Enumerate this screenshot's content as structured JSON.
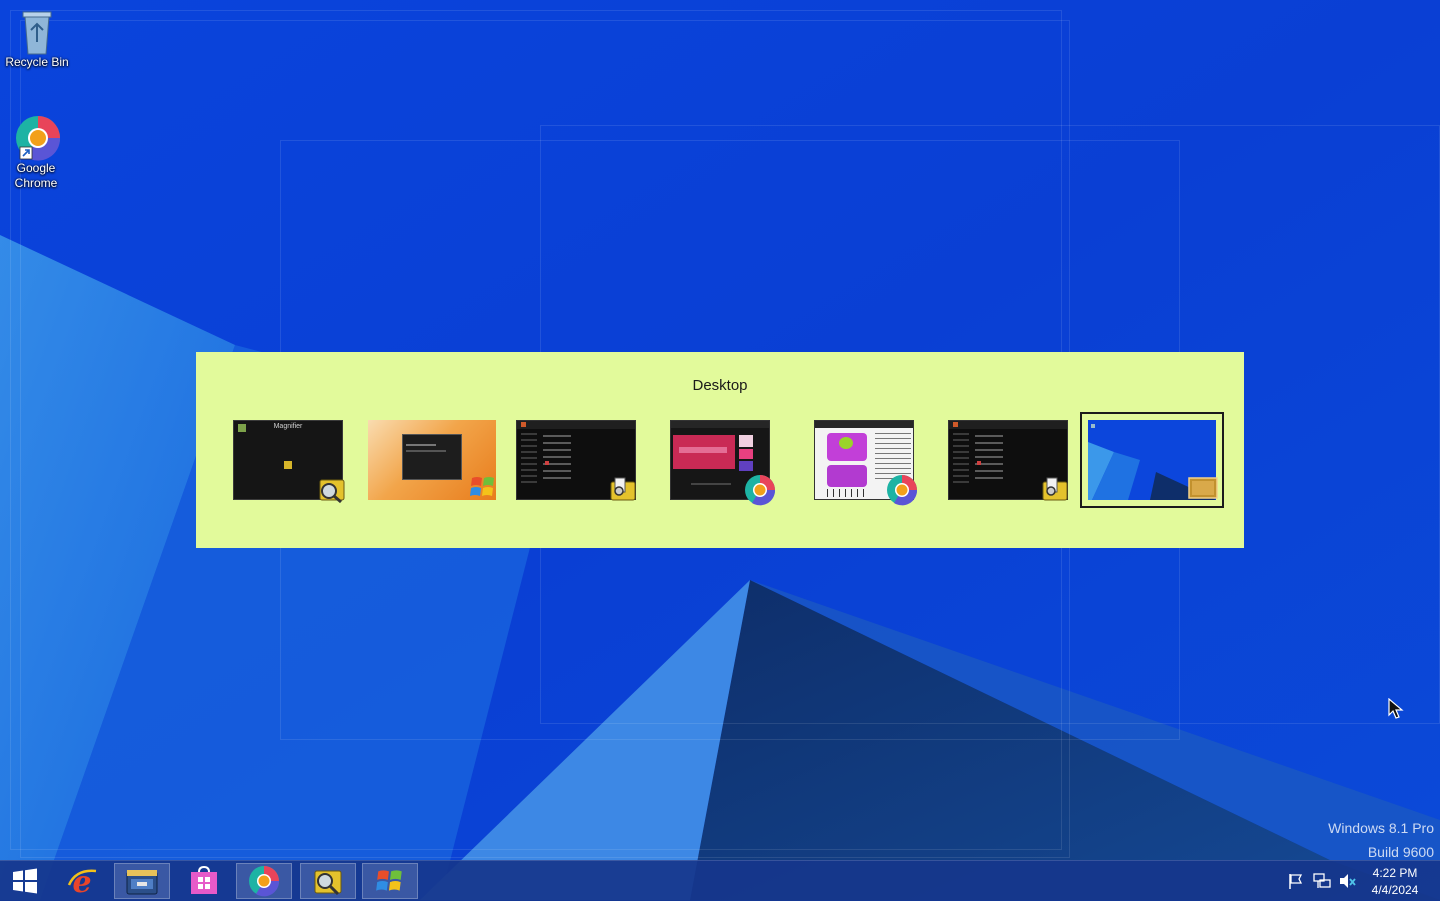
{
  "desktop": {
    "icons": [
      {
        "label": "Recycle Bin",
        "icon": "recycle-bin-icon"
      },
      {
        "label": "Google Chrome",
        "icon": "chrome-icon"
      }
    ]
  },
  "switcher": {
    "title": "Desktop",
    "thumbnails": [
      {
        "name": "magnifier-window",
        "icon": "magnifier-icon",
        "caption": "Magnifier"
      },
      {
        "name": "windows-orange-window",
        "icon": "windows-flag-icon"
      },
      {
        "name": "dark-explorer-window-1",
        "icon": "explorer-icon"
      },
      {
        "name": "chrome-window-1",
        "icon": "chrome-icon"
      },
      {
        "name": "chrome-window-2",
        "icon": "chrome-icon"
      },
      {
        "name": "dark-explorer-window-2",
        "icon": "explorer-icon"
      },
      {
        "name": "desktop-preview",
        "icon": "desktop-icon",
        "selected": true
      }
    ]
  },
  "taskbar": {
    "buttons": [
      {
        "name": "start-button",
        "icon": "windows-logo-icon"
      },
      {
        "name": "internet-explorer-button",
        "icon": "ie-icon"
      },
      {
        "name": "file-explorer-button",
        "icon": "file-explorer-icon"
      },
      {
        "name": "store-button",
        "icon": "store-icon"
      },
      {
        "name": "chrome-button",
        "icon": "chrome-icon"
      },
      {
        "name": "magnifier-button",
        "icon": "magnifier-icon"
      },
      {
        "name": "windows-app-button",
        "icon": "windows-flag-icon"
      }
    ],
    "tray": {
      "icons": [
        "action-center-flag-icon",
        "network-icon",
        "volume-muted-icon"
      ],
      "time": "4:22 PM",
      "date": "4/4/2024"
    }
  },
  "watermark": {
    "line1": "Windows 8.1 Pro",
    "line2": "Build 9600"
  },
  "colors": {
    "switcher_bg": "#e2fa9b",
    "desktop_blue": "#0a3fd6",
    "taskbar": "#16368c"
  }
}
